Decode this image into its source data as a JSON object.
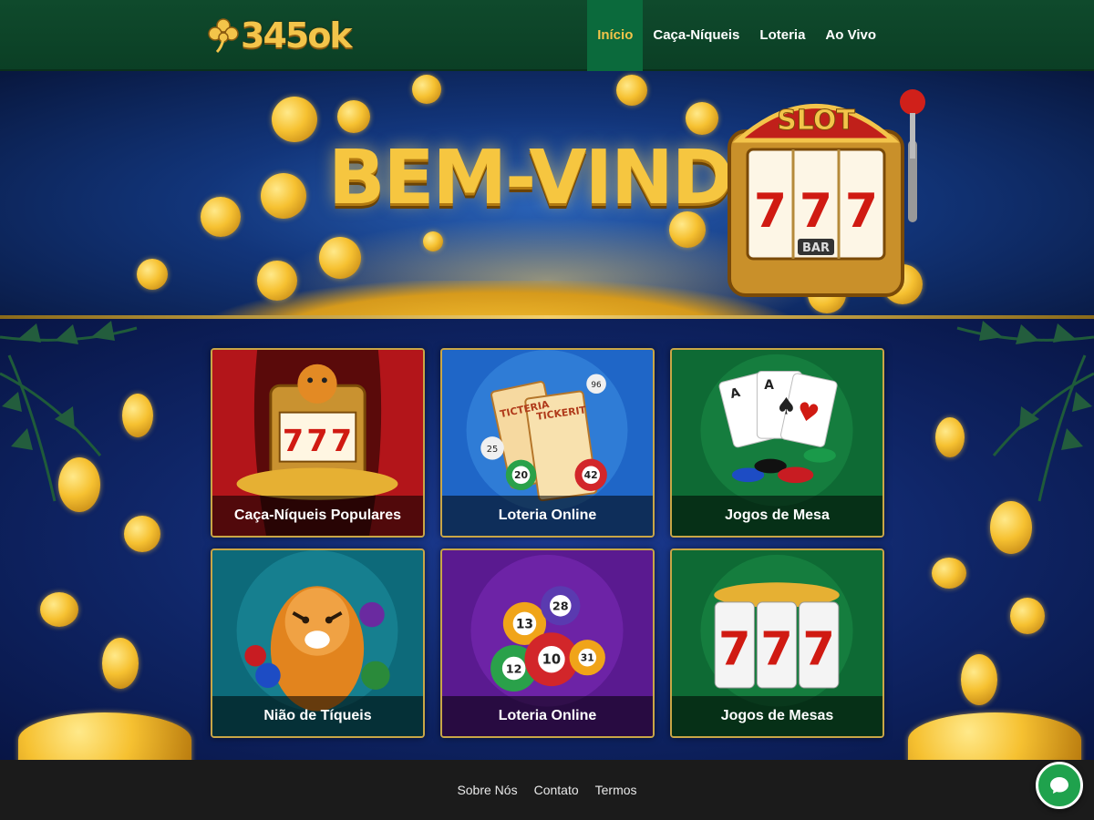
{
  "header": {
    "logo_text": "345ok",
    "nav": [
      {
        "label": "Início",
        "active": true
      },
      {
        "label": "Caça-Níqueis",
        "active": false
      },
      {
        "label": "Loteria",
        "active": false
      },
      {
        "label": "Ao Vivo",
        "active": false
      }
    ]
  },
  "hero": {
    "title": "BEM-VINDO!",
    "slot_sign": "SLOT",
    "slot_symbol": "BAR"
  },
  "cards": [
    {
      "label": "Caça-Níqueis Populares",
      "art": "slot-machine-tiger",
      "reels": [
        "7",
        "7",
        "7"
      ]
    },
    {
      "label": "Loteria Online",
      "art": "lottery-tickets",
      "ticket_text": [
        "TICTERIA",
        "TICKERIT"
      ],
      "balls": [
        "25",
        "20",
        "42",
        "96"
      ]
    },
    {
      "label": "Jogos de Mesa",
      "art": "cards-and-chips"
    },
    {
      "label": "Nião de Tíqueis",
      "art": "tiger-fruits"
    },
    {
      "label": "Loteria Online",
      "art": "bingo-balls",
      "balls": [
        "13",
        "28",
        "12",
        "10",
        "31"
      ]
    },
    {
      "label": "Jogos de Mesas",
      "art": "lucky-777",
      "reels": [
        "7",
        "7",
        "7"
      ]
    }
  ],
  "footer": {
    "links": [
      "Sobre Nós",
      "Contato",
      "Termos"
    ]
  },
  "colors": {
    "header_bg": "#0f4a2c",
    "nav_active_bg": "#0b6a3c",
    "gold": "#f3c44a",
    "main_bg": "#0f2566",
    "footer_bg": "#1b1b1b",
    "chat_button": "#1fa24d"
  },
  "icons": {
    "logo": "clover-icon",
    "chat": "chat-bubble-icon"
  }
}
